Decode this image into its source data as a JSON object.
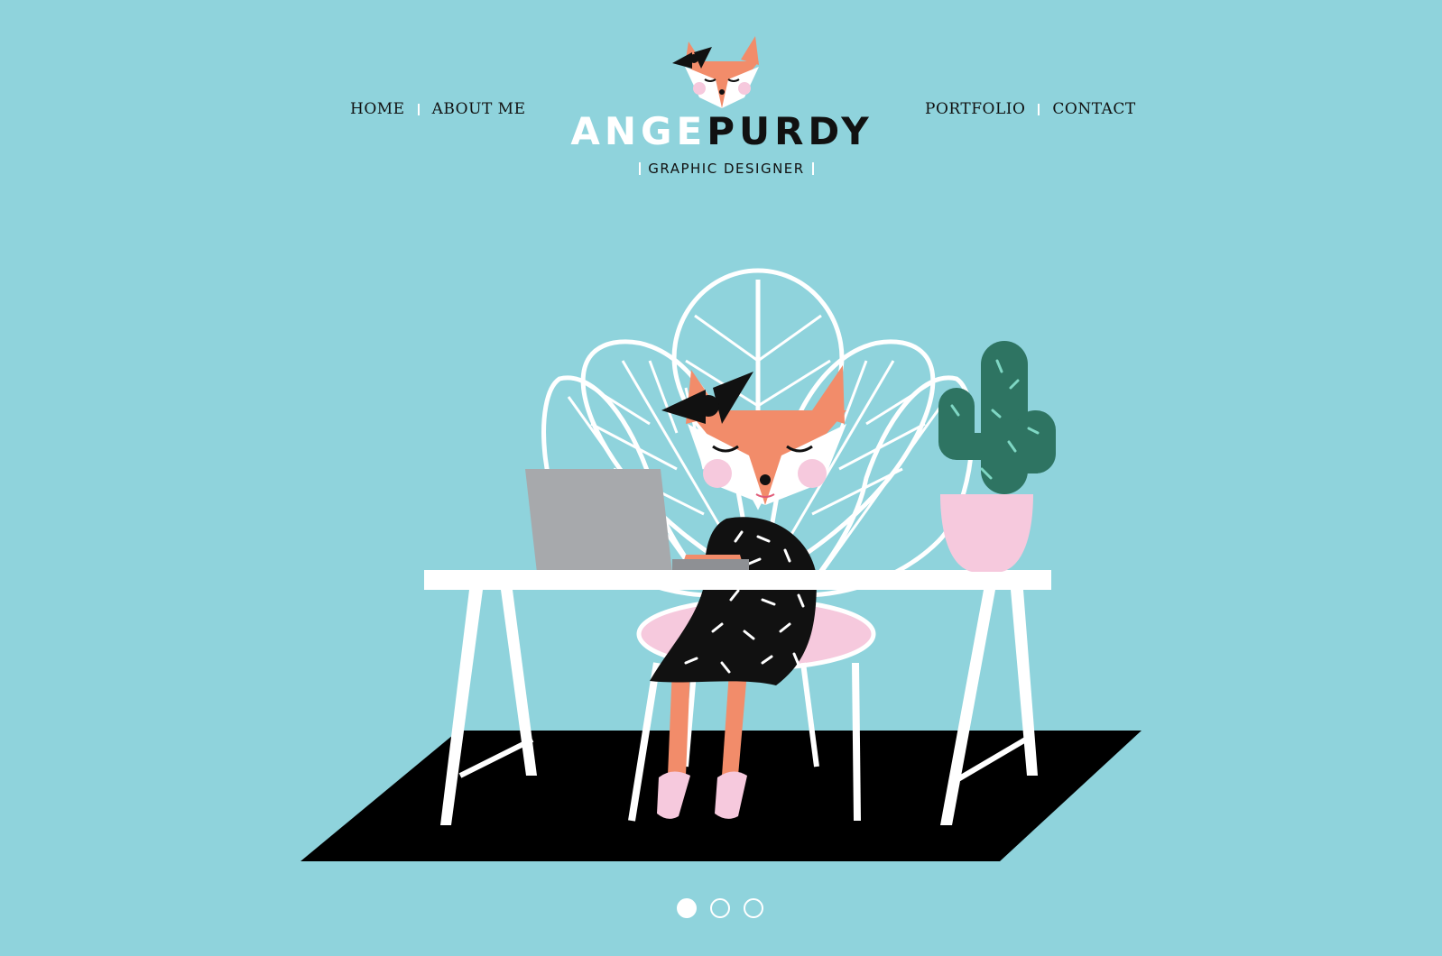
{
  "nav": {
    "home": "HOME",
    "about": "ABOUT ME",
    "portfolio": "PORTFOLIO",
    "contact": "CONTACT"
  },
  "brand": {
    "first": "ANGE",
    "last": "PURDY",
    "tagline": "GRAPHIC DESIGNER"
  },
  "hero": {
    "illustration": "fox-designer-at-desk",
    "icons": [
      "fox-logo-icon",
      "laptop-icon",
      "cactus-icon",
      "peacock-chair-icon"
    ]
  },
  "carousel": {
    "count": 3,
    "active": 1
  },
  "colors": {
    "background": "#8fd3dc",
    "fox": "#f28c6a",
    "black": "#111111",
    "white": "#ffffff",
    "pink": "#f6c9dd",
    "cactus": "#2e7462",
    "laptop": "#a7a9ac"
  }
}
